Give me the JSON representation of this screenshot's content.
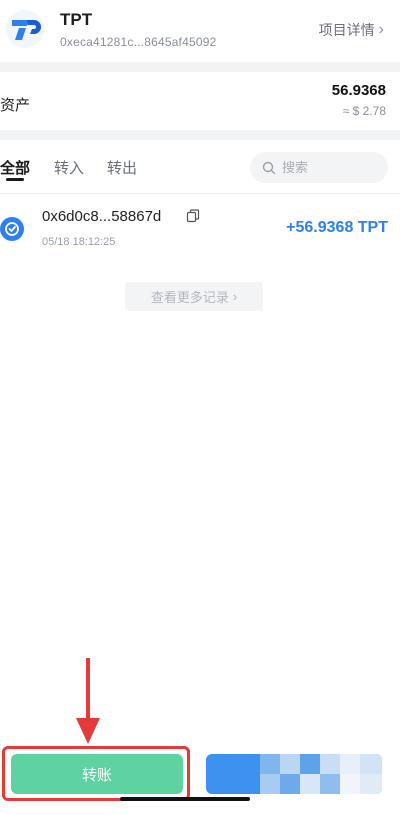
{
  "header": {
    "token_name": "TPT",
    "token_address": "0xeca41281c...8645af45092",
    "detail_link": "项目详情",
    "detail_chevron": "›"
  },
  "asset": {
    "label": "资产",
    "amount": "56.9368",
    "usd_value": "≈ $ 2.78"
  },
  "tabs": {
    "items": [
      {
        "label": "全部",
        "active": true
      },
      {
        "label": "转入",
        "active": false
      },
      {
        "label": "转出",
        "active": false
      }
    ]
  },
  "search": {
    "placeholder": "搜索",
    "icon": "search-icon"
  },
  "transactions": [
    {
      "hash": "0x6d0c8...58867d",
      "time": "05/18 18:12:25",
      "amount": "+56.9368 TPT",
      "status_icon": "check-circle-icon",
      "amount_color": "#2f80ed"
    }
  ],
  "more_records": {
    "label": "查看更多记录",
    "chevron": "›"
  },
  "footer": {
    "transfer_label": "转账",
    "transfer_color": "#5ed3a1",
    "receive_color": "#3d92ef",
    "highlight_color": "#e53a3a",
    "arrow_color": "#e53a3a"
  }
}
